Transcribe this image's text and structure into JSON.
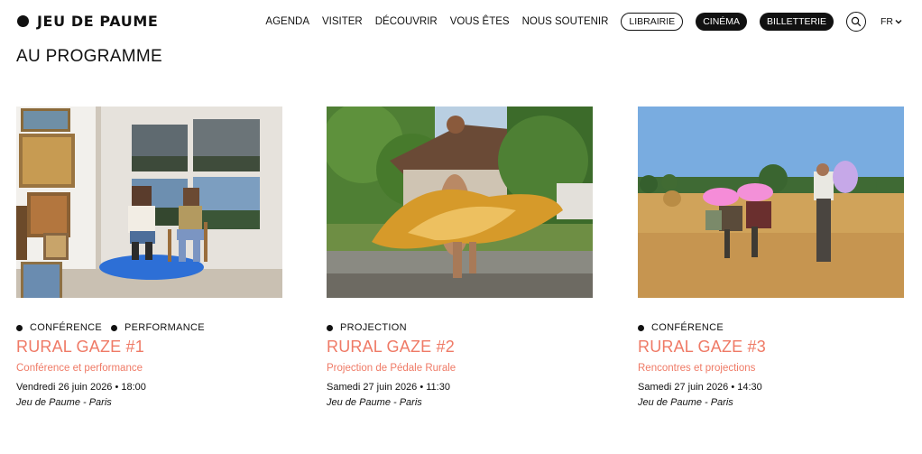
{
  "header": {
    "logo": "JEU DE PAUME",
    "nav": [
      "AGENDA",
      "VISITER",
      "DÉCOUVRIR",
      "VOUS ÊTES",
      "NOUS SOUTENIR"
    ],
    "librairie": "LIBRAIRIE",
    "cinema": "CINÉMA",
    "billetterie": "BILLETTERIE",
    "lang": "FR"
  },
  "main": {
    "title": "AU PROGRAMME",
    "cards": [
      {
        "tags": [
          "CONFÉRENCE",
          "PERFORMANCE"
        ],
        "title": "RURAL GAZE #1",
        "subtitle": "Conférence et performance",
        "date": "Vendredi 26 juin 2026 • 18:00",
        "place": "Jeu de Paume - Paris"
      },
      {
        "tags": [
          "PROJECTION"
        ],
        "title": "RURAL GAZE #2",
        "subtitle": "Projection de Pédale Rurale",
        "date": "Samedi 27 juin 2026 • 11:30",
        "place": "Jeu de Paume - Paris"
      },
      {
        "tags": [
          "CONFÉRENCE"
        ],
        "title": "RURAL GAZE #3",
        "subtitle": "Rencontres et projections",
        "date": "Samedi 27 juin 2026 • 14:30",
        "place": "Jeu de Paume - Paris"
      }
    ]
  },
  "colors": {
    "accent": "#ef7a66",
    "text": "#111111"
  }
}
